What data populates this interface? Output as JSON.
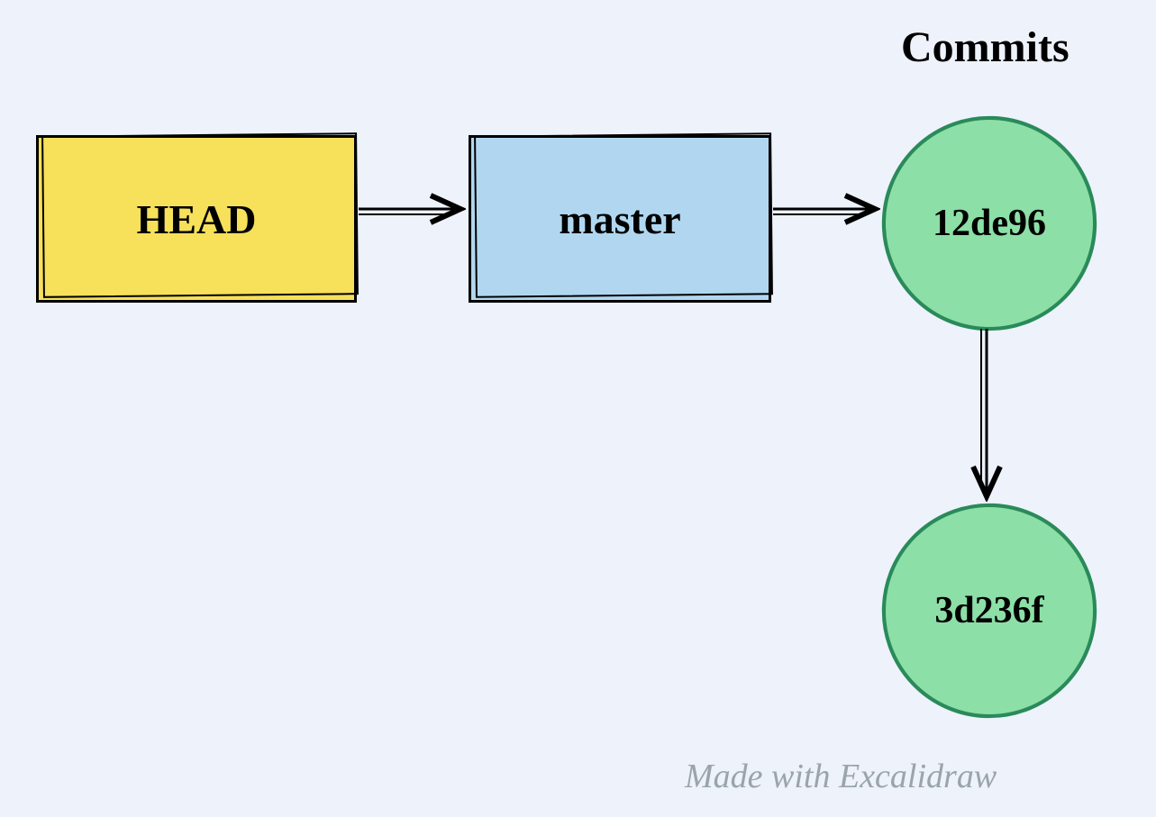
{
  "title": "Commits",
  "head": {
    "label": "HEAD"
  },
  "branch": {
    "label": "master"
  },
  "commits": [
    {
      "hash": "12de96"
    },
    {
      "hash": "3d236f"
    }
  ],
  "credit": "Made with Excalidraw",
  "colors": {
    "background": "#edf2fb",
    "head_fill": "#f7e05a",
    "branch_fill": "#b1d7f0",
    "commit_fill": "#8cdfa6",
    "commit_stroke": "#2a8a5a"
  },
  "edges": [
    {
      "from": "HEAD",
      "to": "master"
    },
    {
      "from": "master",
      "to": "12de96"
    },
    {
      "from": "12de96",
      "to": "3d236f"
    }
  ]
}
